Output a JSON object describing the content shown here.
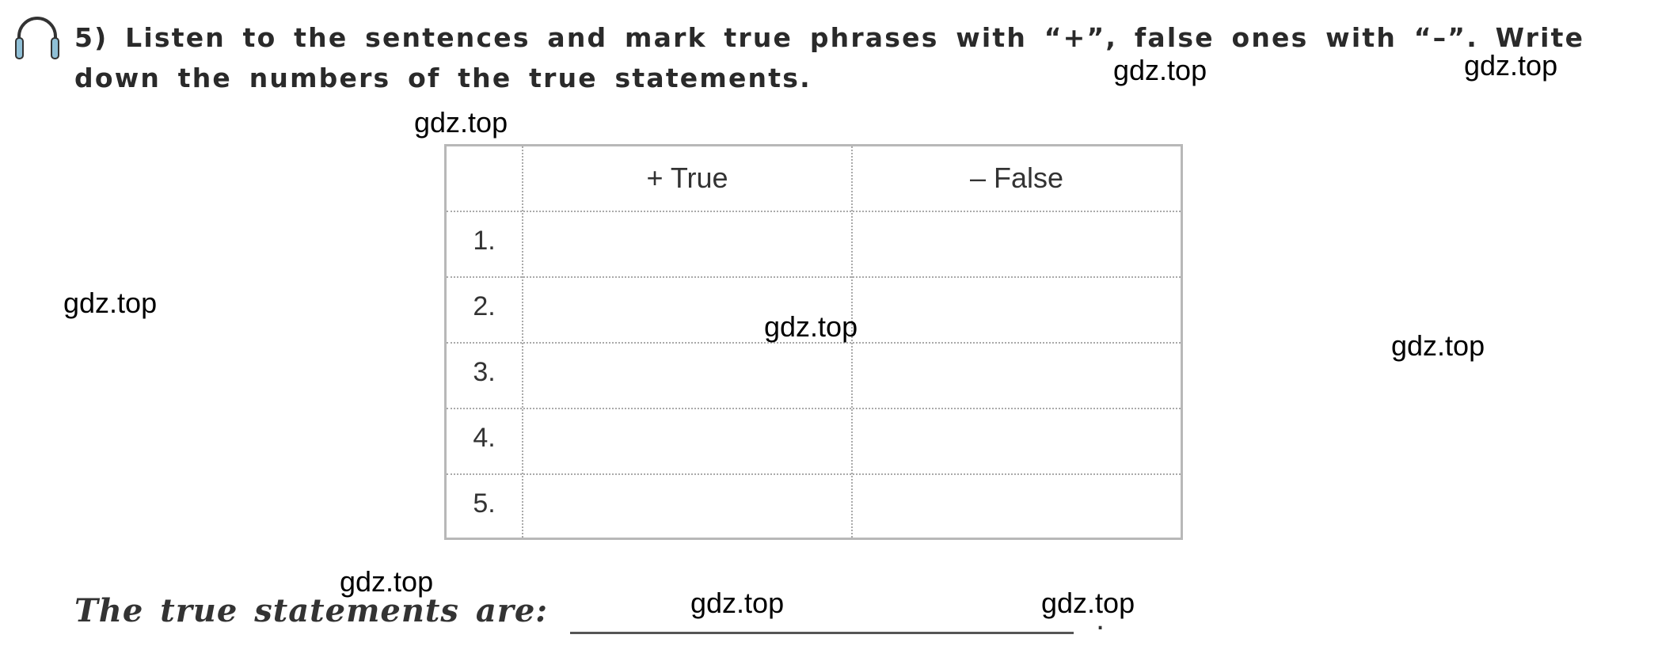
{
  "exercise": {
    "icon": "headphones-icon",
    "instruction": "5) Listen to the sentences and mark true phrases with “+”, false ones with “–”. Write down the numbers of the true statements."
  },
  "table": {
    "headers": [
      "",
      "+ True",
      "– False"
    ],
    "rows": [
      "1.",
      "2.",
      "3.",
      "4.",
      "5."
    ]
  },
  "answer": {
    "label": "The true statements are:",
    "value": "",
    "end": "."
  },
  "watermarks": [
    "gdz.top",
    "gdz.top",
    "gdz.top",
    "gdz.top",
    "gdz.top",
    "gdz.top",
    "gdz.top",
    "gdz.top",
    "gdz.top"
  ]
}
